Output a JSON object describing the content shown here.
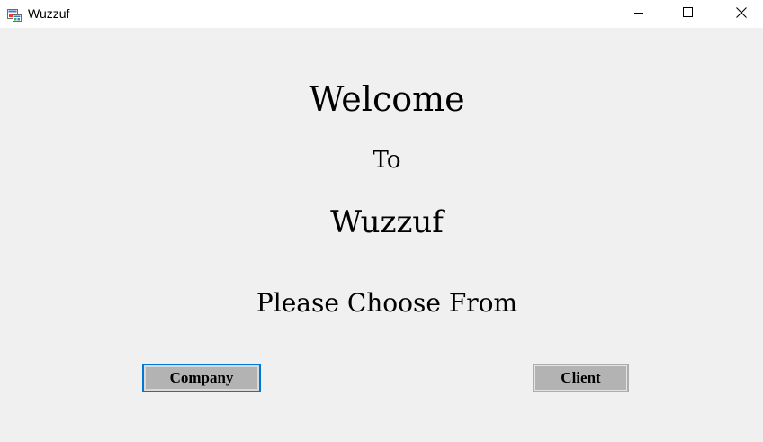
{
  "window": {
    "title": "Wuzzuf",
    "app_icon": "windows-form-icon",
    "controls": {
      "minimize_icon": "minimize-icon",
      "maximize_icon": "maximize-icon",
      "close_icon": "close-icon"
    }
  },
  "main": {
    "welcome": "Welcome",
    "to": "To",
    "app_name": "Wuzzuf",
    "prompt": "Please Choose From"
  },
  "buttons": {
    "company_label": "Company",
    "client_label": "Client"
  },
  "colors": {
    "background": "#f0f0f0",
    "titlebar": "#ffffff",
    "button_face": "#b3b3b3",
    "focus_border": "#0078d7"
  }
}
